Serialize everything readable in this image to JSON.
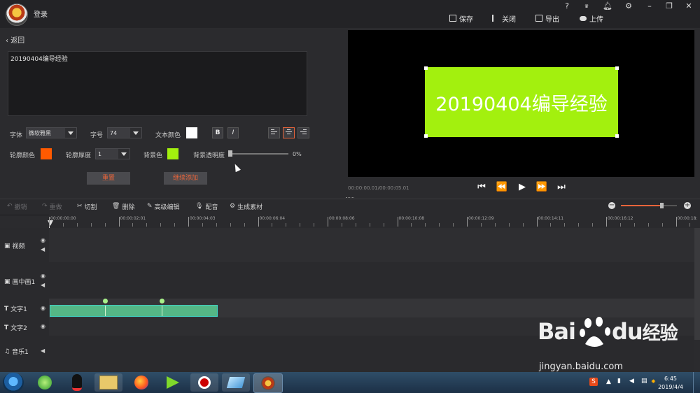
{
  "app": {
    "login_label": "登录",
    "actions": {
      "save": "保存",
      "close": "关闭",
      "export": "导出",
      "upload": "上传"
    },
    "window_controls": [
      "?",
      "VIP",
      "bell",
      "gear",
      "minimize",
      "restore",
      "close"
    ]
  },
  "editor": {
    "back_label": "返回",
    "text_content": "20190404编导经验",
    "font_label": "字体",
    "font_value": "微软雅黑",
    "size_label": "字号",
    "size_value": "74",
    "text_color_label": "文本颜色",
    "text_color": "#ffffff",
    "bold_label": "B",
    "italic_label": "I",
    "outline_color_label": "轮廓颜色",
    "outline_color": "#ff5a00",
    "outline_thickness_label": "轮廓厚度",
    "outline_thickness_value": "1",
    "bg_color_label": "背景色",
    "bg_color": "#a3f00e",
    "bg_opacity_label": "背景透明度",
    "bg_opacity_value": "0%",
    "reset_label": "重置",
    "continue_add_label": "继续添加"
  },
  "preview": {
    "text": "20190404编导经验",
    "timecode": "00:00:00.01/00:00:05.01"
  },
  "toolbar": {
    "undo": "撤销",
    "redo": "重做",
    "cut": "切割",
    "delete": "删除",
    "advanced_edit": "高级编辑",
    "dub": "配音",
    "generate": "生成素材",
    "zoom_level": 0.72
  },
  "ruler": {
    "ticks": [
      "00:00:00:00",
      "00:00:02:01",
      "00:00:04:03",
      "00:00:06:04",
      "00:00:08:06",
      "00:00:10:08",
      "00:00:12:09",
      "00:00:14:11",
      "00:00:16:12",
      "00:00:18:"
    ]
  },
  "tracks": [
    {
      "name": "视频",
      "icon": "video-icon"
    },
    {
      "name": "画中画1",
      "icon": "pip-icon"
    },
    {
      "name": "文字1",
      "icon": "text-icon"
    },
    {
      "name": "文字2",
      "icon": "text-icon"
    },
    {
      "name": "音乐1",
      "icon": "music-icon"
    }
  ],
  "taskbar": {
    "time": "6:45",
    "date": "2019/4/4"
  },
  "watermark": {
    "brand": "Bai",
    "brand_suffix": "du",
    "cn": "经验",
    "url": "jingyan.baidu.com"
  },
  "colors": {
    "accent": "#e8643a",
    "clip": "#55b786",
    "preview_bg": "#a3f00e"
  }
}
